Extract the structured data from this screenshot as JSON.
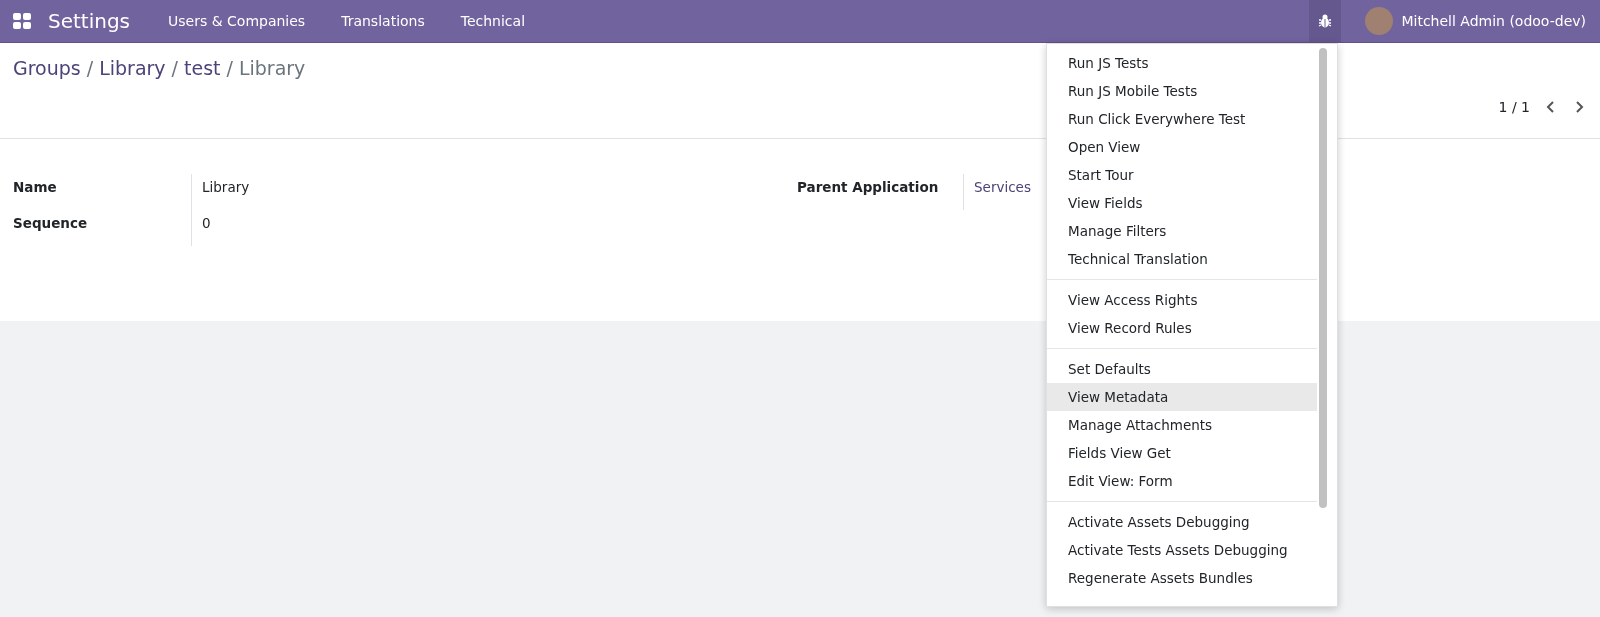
{
  "navbar": {
    "app_name": "Settings",
    "menus": [
      "Users & Companies",
      "Translations",
      "Technical"
    ],
    "user": "Mitchell Admin (odoo-dev)",
    "debug_open": true
  },
  "breadcrumb": {
    "links": [
      "Groups",
      "Library",
      "test"
    ],
    "separator": "/",
    "current": "Library"
  },
  "pager": {
    "value": "1 / 1"
  },
  "form": {
    "left": [
      {
        "label": "Name",
        "value": "Library"
      },
      {
        "label": "Sequence",
        "value": "0"
      }
    ],
    "right": [
      {
        "label": "Parent Application",
        "value": "Services"
      }
    ]
  },
  "debug_menu": {
    "sections": [
      [
        {
          "label": "Run JS Tests",
          "highlighted": false
        },
        {
          "label": "Run JS Mobile Tests",
          "highlighted": false
        },
        {
          "label": "Run Click Everywhere Test",
          "highlighted": false
        },
        {
          "label": "Open View",
          "highlighted": false
        },
        {
          "label": "Start Tour",
          "highlighted": false
        },
        {
          "label": "View Fields",
          "highlighted": false
        },
        {
          "label": "Manage Filters",
          "highlighted": false
        },
        {
          "label": "Technical Translation",
          "highlighted": false
        }
      ],
      [
        {
          "label": "View Access Rights",
          "highlighted": false
        },
        {
          "label": "View Record Rules",
          "highlighted": false
        }
      ],
      [
        {
          "label": "Set Defaults",
          "highlighted": false
        },
        {
          "label": "View Metadata",
          "highlighted": true
        },
        {
          "label": "Manage Attachments",
          "highlighted": false
        },
        {
          "label": "Fields View Get",
          "highlighted": false
        },
        {
          "label": "Edit View: Form",
          "highlighted": false
        }
      ],
      [
        {
          "label": "Activate Assets Debugging",
          "highlighted": false
        },
        {
          "label": "Activate Tests Assets Debugging",
          "highlighted": false
        },
        {
          "label": "Regenerate Assets Bundles",
          "highlighted": false
        }
      ]
    ]
  }
}
